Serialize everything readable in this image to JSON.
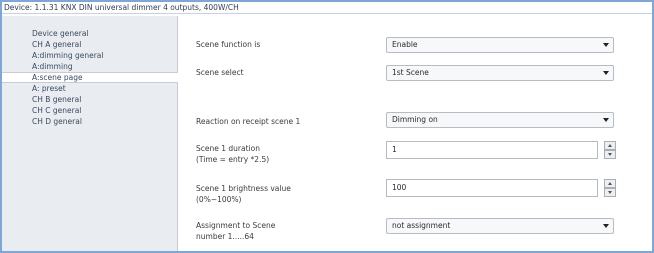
{
  "window": {
    "title": "Device: 1.1.31  KNX DIN universal dimmer 4 outputs, 400W/CH"
  },
  "sidebar": {
    "items": [
      {
        "label": "Device general",
        "selected": false
      },
      {
        "label": "CH A general",
        "selected": false
      },
      {
        "label": "A:dimming general",
        "selected": false
      },
      {
        "label": "A:dimming",
        "selected": false
      },
      {
        "label": "A:scene page",
        "selected": true
      },
      {
        "label": "A: preset",
        "selected": false
      },
      {
        "label": "CH B general",
        "selected": false
      },
      {
        "label": "CH C general",
        "selected": false
      },
      {
        "label": "CH D general",
        "selected": false
      }
    ]
  },
  "params": {
    "scene_function": {
      "label": "Scene function is",
      "value": "Enable"
    },
    "scene_select": {
      "label": "Scene  select",
      "value": "1st Scene"
    },
    "reaction": {
      "label": "Reaction on receipt scene 1",
      "value": "Dimming on"
    },
    "duration": {
      "label_line1": "Scene 1 duration",
      "label_line2": "(Time = entry *2.5)",
      "value": "1"
    },
    "brightness": {
      "label_line1": "Scene 1 brightness value",
      "label_line2": "(0%~100%)",
      "value": "100"
    },
    "assignment": {
      "label_line1": "Assignment to Scene",
      "label_line2": "number 1.....64",
      "value": "not assignment"
    }
  },
  "icons": {
    "dropdown": "chevron-down-icon",
    "spin_up": "spin-up-icon",
    "spin_down": "spin-down-icon"
  },
  "colors": {
    "frame_border": "#7fa7d6",
    "sidebar_bg": "#e9edf2",
    "selected_bg": "#ffffff"
  }
}
